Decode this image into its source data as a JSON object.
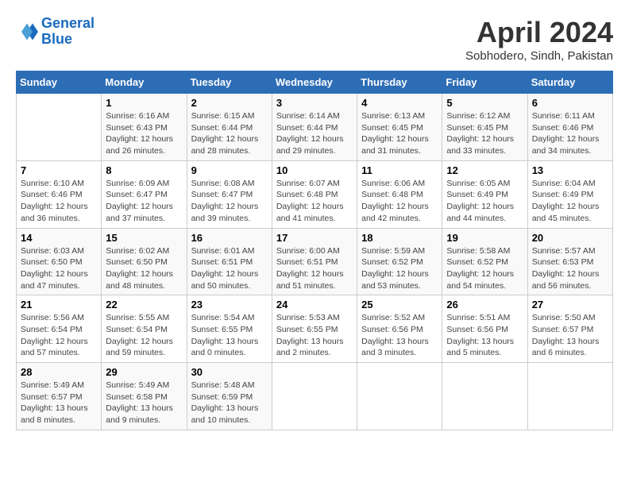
{
  "header": {
    "logo_line1": "General",
    "logo_line2": "Blue",
    "month": "April 2024",
    "location": "Sobhodero, Sindh, Pakistan"
  },
  "weekdays": [
    "Sunday",
    "Monday",
    "Tuesday",
    "Wednesday",
    "Thursday",
    "Friday",
    "Saturday"
  ],
  "weeks": [
    [
      {
        "day": "",
        "info": ""
      },
      {
        "day": "1",
        "info": "Sunrise: 6:16 AM\nSunset: 6:43 PM\nDaylight: 12 hours\nand 26 minutes."
      },
      {
        "day": "2",
        "info": "Sunrise: 6:15 AM\nSunset: 6:44 PM\nDaylight: 12 hours\nand 28 minutes."
      },
      {
        "day": "3",
        "info": "Sunrise: 6:14 AM\nSunset: 6:44 PM\nDaylight: 12 hours\nand 29 minutes."
      },
      {
        "day": "4",
        "info": "Sunrise: 6:13 AM\nSunset: 6:45 PM\nDaylight: 12 hours\nand 31 minutes."
      },
      {
        "day": "5",
        "info": "Sunrise: 6:12 AM\nSunset: 6:45 PM\nDaylight: 12 hours\nand 33 minutes."
      },
      {
        "day": "6",
        "info": "Sunrise: 6:11 AM\nSunset: 6:46 PM\nDaylight: 12 hours\nand 34 minutes."
      }
    ],
    [
      {
        "day": "7",
        "info": "Sunrise: 6:10 AM\nSunset: 6:46 PM\nDaylight: 12 hours\nand 36 minutes."
      },
      {
        "day": "8",
        "info": "Sunrise: 6:09 AM\nSunset: 6:47 PM\nDaylight: 12 hours\nand 37 minutes."
      },
      {
        "day": "9",
        "info": "Sunrise: 6:08 AM\nSunset: 6:47 PM\nDaylight: 12 hours\nand 39 minutes."
      },
      {
        "day": "10",
        "info": "Sunrise: 6:07 AM\nSunset: 6:48 PM\nDaylight: 12 hours\nand 41 minutes."
      },
      {
        "day": "11",
        "info": "Sunrise: 6:06 AM\nSunset: 6:48 PM\nDaylight: 12 hours\nand 42 minutes."
      },
      {
        "day": "12",
        "info": "Sunrise: 6:05 AM\nSunset: 6:49 PM\nDaylight: 12 hours\nand 44 minutes."
      },
      {
        "day": "13",
        "info": "Sunrise: 6:04 AM\nSunset: 6:49 PM\nDaylight: 12 hours\nand 45 minutes."
      }
    ],
    [
      {
        "day": "14",
        "info": "Sunrise: 6:03 AM\nSunset: 6:50 PM\nDaylight: 12 hours\nand 47 minutes."
      },
      {
        "day": "15",
        "info": "Sunrise: 6:02 AM\nSunset: 6:50 PM\nDaylight: 12 hours\nand 48 minutes."
      },
      {
        "day": "16",
        "info": "Sunrise: 6:01 AM\nSunset: 6:51 PM\nDaylight: 12 hours\nand 50 minutes."
      },
      {
        "day": "17",
        "info": "Sunrise: 6:00 AM\nSunset: 6:51 PM\nDaylight: 12 hours\nand 51 minutes."
      },
      {
        "day": "18",
        "info": "Sunrise: 5:59 AM\nSunset: 6:52 PM\nDaylight: 12 hours\nand 53 minutes."
      },
      {
        "day": "19",
        "info": "Sunrise: 5:58 AM\nSunset: 6:52 PM\nDaylight: 12 hours\nand 54 minutes."
      },
      {
        "day": "20",
        "info": "Sunrise: 5:57 AM\nSunset: 6:53 PM\nDaylight: 12 hours\nand 56 minutes."
      }
    ],
    [
      {
        "day": "21",
        "info": "Sunrise: 5:56 AM\nSunset: 6:54 PM\nDaylight: 12 hours\nand 57 minutes."
      },
      {
        "day": "22",
        "info": "Sunrise: 5:55 AM\nSunset: 6:54 PM\nDaylight: 12 hours\nand 59 minutes."
      },
      {
        "day": "23",
        "info": "Sunrise: 5:54 AM\nSunset: 6:55 PM\nDaylight: 13 hours\nand 0 minutes."
      },
      {
        "day": "24",
        "info": "Sunrise: 5:53 AM\nSunset: 6:55 PM\nDaylight: 13 hours\nand 2 minutes."
      },
      {
        "day": "25",
        "info": "Sunrise: 5:52 AM\nSunset: 6:56 PM\nDaylight: 13 hours\nand 3 minutes."
      },
      {
        "day": "26",
        "info": "Sunrise: 5:51 AM\nSunset: 6:56 PM\nDaylight: 13 hours\nand 5 minutes."
      },
      {
        "day": "27",
        "info": "Sunrise: 5:50 AM\nSunset: 6:57 PM\nDaylight: 13 hours\nand 6 minutes."
      }
    ],
    [
      {
        "day": "28",
        "info": "Sunrise: 5:49 AM\nSunset: 6:57 PM\nDaylight: 13 hours\nand 8 minutes."
      },
      {
        "day": "29",
        "info": "Sunrise: 5:49 AM\nSunset: 6:58 PM\nDaylight: 13 hours\nand 9 minutes."
      },
      {
        "day": "30",
        "info": "Sunrise: 5:48 AM\nSunset: 6:59 PM\nDaylight: 13 hours\nand 10 minutes."
      },
      {
        "day": "",
        "info": ""
      },
      {
        "day": "",
        "info": ""
      },
      {
        "day": "",
        "info": ""
      },
      {
        "day": "",
        "info": ""
      }
    ]
  ]
}
